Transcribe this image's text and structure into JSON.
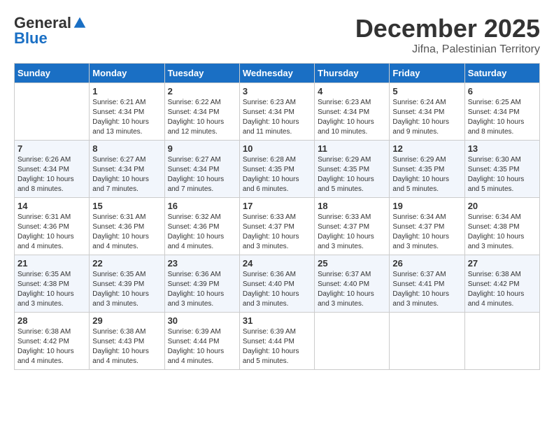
{
  "logo": {
    "general": "General",
    "blue": "Blue"
  },
  "header": {
    "month": "December 2025",
    "location": "Jifna, Palestinian Territory"
  },
  "weekdays": [
    "Sunday",
    "Monday",
    "Tuesday",
    "Wednesday",
    "Thursday",
    "Friday",
    "Saturday"
  ],
  "weeks": [
    [
      {
        "day": "",
        "info": ""
      },
      {
        "day": "1",
        "info": "Sunrise: 6:21 AM\nSunset: 4:34 PM\nDaylight: 10 hours\nand 13 minutes."
      },
      {
        "day": "2",
        "info": "Sunrise: 6:22 AM\nSunset: 4:34 PM\nDaylight: 10 hours\nand 12 minutes."
      },
      {
        "day": "3",
        "info": "Sunrise: 6:23 AM\nSunset: 4:34 PM\nDaylight: 10 hours\nand 11 minutes."
      },
      {
        "day": "4",
        "info": "Sunrise: 6:23 AM\nSunset: 4:34 PM\nDaylight: 10 hours\nand 10 minutes."
      },
      {
        "day": "5",
        "info": "Sunrise: 6:24 AM\nSunset: 4:34 PM\nDaylight: 10 hours\nand 9 minutes."
      },
      {
        "day": "6",
        "info": "Sunrise: 6:25 AM\nSunset: 4:34 PM\nDaylight: 10 hours\nand 8 minutes."
      }
    ],
    [
      {
        "day": "7",
        "info": "Sunrise: 6:26 AM\nSunset: 4:34 PM\nDaylight: 10 hours\nand 8 minutes."
      },
      {
        "day": "8",
        "info": "Sunrise: 6:27 AM\nSunset: 4:34 PM\nDaylight: 10 hours\nand 7 minutes."
      },
      {
        "day": "9",
        "info": "Sunrise: 6:27 AM\nSunset: 4:34 PM\nDaylight: 10 hours\nand 7 minutes."
      },
      {
        "day": "10",
        "info": "Sunrise: 6:28 AM\nSunset: 4:35 PM\nDaylight: 10 hours\nand 6 minutes."
      },
      {
        "day": "11",
        "info": "Sunrise: 6:29 AM\nSunset: 4:35 PM\nDaylight: 10 hours\nand 5 minutes."
      },
      {
        "day": "12",
        "info": "Sunrise: 6:29 AM\nSunset: 4:35 PM\nDaylight: 10 hours\nand 5 minutes."
      },
      {
        "day": "13",
        "info": "Sunrise: 6:30 AM\nSunset: 4:35 PM\nDaylight: 10 hours\nand 5 minutes."
      }
    ],
    [
      {
        "day": "14",
        "info": "Sunrise: 6:31 AM\nSunset: 4:36 PM\nDaylight: 10 hours\nand 4 minutes."
      },
      {
        "day": "15",
        "info": "Sunrise: 6:31 AM\nSunset: 4:36 PM\nDaylight: 10 hours\nand 4 minutes."
      },
      {
        "day": "16",
        "info": "Sunrise: 6:32 AM\nSunset: 4:36 PM\nDaylight: 10 hours\nand 4 minutes."
      },
      {
        "day": "17",
        "info": "Sunrise: 6:33 AM\nSunset: 4:37 PM\nDaylight: 10 hours\nand 3 minutes."
      },
      {
        "day": "18",
        "info": "Sunrise: 6:33 AM\nSunset: 4:37 PM\nDaylight: 10 hours\nand 3 minutes."
      },
      {
        "day": "19",
        "info": "Sunrise: 6:34 AM\nSunset: 4:37 PM\nDaylight: 10 hours\nand 3 minutes."
      },
      {
        "day": "20",
        "info": "Sunrise: 6:34 AM\nSunset: 4:38 PM\nDaylight: 10 hours\nand 3 minutes."
      }
    ],
    [
      {
        "day": "21",
        "info": "Sunrise: 6:35 AM\nSunset: 4:38 PM\nDaylight: 10 hours\nand 3 minutes."
      },
      {
        "day": "22",
        "info": "Sunrise: 6:35 AM\nSunset: 4:39 PM\nDaylight: 10 hours\nand 3 minutes."
      },
      {
        "day": "23",
        "info": "Sunrise: 6:36 AM\nSunset: 4:39 PM\nDaylight: 10 hours\nand 3 minutes."
      },
      {
        "day": "24",
        "info": "Sunrise: 6:36 AM\nSunset: 4:40 PM\nDaylight: 10 hours\nand 3 minutes."
      },
      {
        "day": "25",
        "info": "Sunrise: 6:37 AM\nSunset: 4:40 PM\nDaylight: 10 hours\nand 3 minutes."
      },
      {
        "day": "26",
        "info": "Sunrise: 6:37 AM\nSunset: 4:41 PM\nDaylight: 10 hours\nand 3 minutes."
      },
      {
        "day": "27",
        "info": "Sunrise: 6:38 AM\nSunset: 4:42 PM\nDaylight: 10 hours\nand 4 minutes."
      }
    ],
    [
      {
        "day": "28",
        "info": "Sunrise: 6:38 AM\nSunset: 4:42 PM\nDaylight: 10 hours\nand 4 minutes."
      },
      {
        "day": "29",
        "info": "Sunrise: 6:38 AM\nSunset: 4:43 PM\nDaylight: 10 hours\nand 4 minutes."
      },
      {
        "day": "30",
        "info": "Sunrise: 6:39 AM\nSunset: 4:44 PM\nDaylight: 10 hours\nand 4 minutes."
      },
      {
        "day": "31",
        "info": "Sunrise: 6:39 AM\nSunset: 4:44 PM\nDaylight: 10 hours\nand 5 minutes."
      },
      {
        "day": "",
        "info": ""
      },
      {
        "day": "",
        "info": ""
      },
      {
        "day": "",
        "info": ""
      }
    ]
  ]
}
